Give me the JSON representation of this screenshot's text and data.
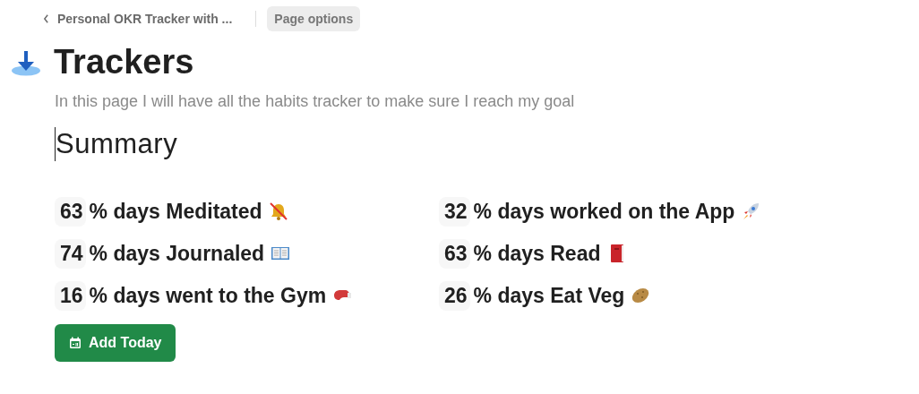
{
  "breadcrumb": {
    "back_label": "Personal OKR Tracker with ...",
    "page_options": "Page options"
  },
  "title": "Trackers",
  "description": "In this page I will have all the habits tracker to make sure I reach my goal",
  "heading": "Summary",
  "stats": [
    {
      "value": "63",
      "label": "% days Meditated",
      "kind": "muted-bell"
    },
    {
      "value": "32",
      "label": "% days worked on the App",
      "kind": "rocket"
    },
    {
      "value": "74",
      "label": "% days Journaled",
      "kind": "open-book"
    },
    {
      "value": "63",
      "label": "% days Read",
      "kind": "red-book"
    },
    {
      "value": "16",
      "label": "% days went to the Gym",
      "kind": "boxing-glove"
    },
    {
      "value": "26",
      "label": "% days Eat Veg",
      "kind": "potato"
    }
  ],
  "button": {
    "label": "Add Today"
  }
}
